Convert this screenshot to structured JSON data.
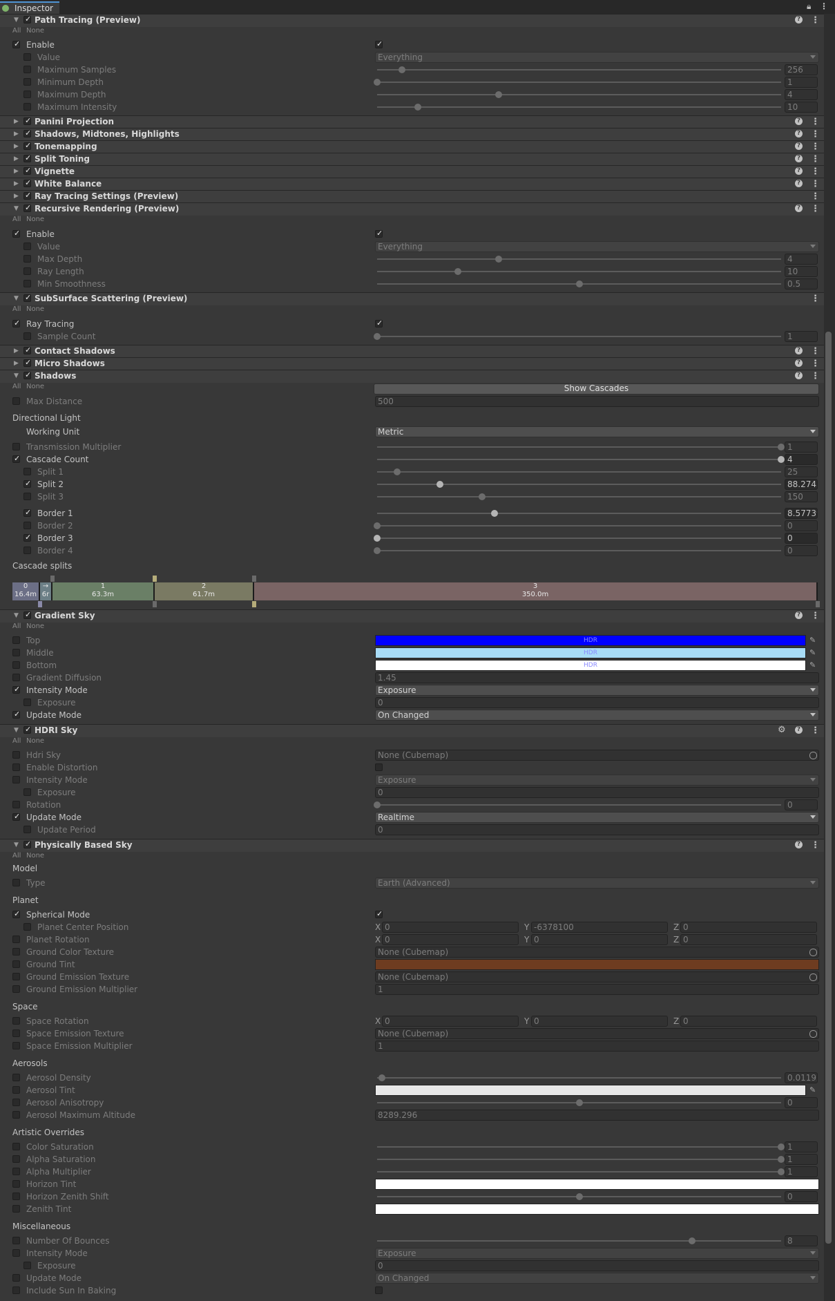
{
  "window": {
    "tab_label": "Inspector"
  },
  "path_tracing": {
    "title": "Path Tracing (Preview)",
    "all": "All",
    "none": "None",
    "enable": "Enable",
    "value_label": "Value",
    "value": "Everything",
    "max_samples_label": "Maximum Samples",
    "max_samples": "256",
    "min_depth_label": "Minimum Depth",
    "min_depth": "1",
    "max_depth_label": "Maximum Depth",
    "max_depth": "4",
    "max_intensity_label": "Maximum Intensity",
    "max_intensity": "10"
  },
  "collapsed": [
    "Panini Projection",
    "Shadows, Midtones, Highlights",
    "Tonemapping",
    "Split Toning",
    "Vignette",
    "White Balance",
    "Ray Tracing Settings (Preview)"
  ],
  "recursive": {
    "title": "Recursive Rendering (Preview)",
    "all": "All",
    "none": "None",
    "enable": "Enable",
    "value_label": "Value",
    "value": "Everything",
    "max_depth_label": "Max Depth",
    "max_depth": "4",
    "ray_length_label": "Ray Length",
    "ray_length": "10",
    "min_smooth_label": "Min Smoothness",
    "min_smooth": "0.5"
  },
  "sss": {
    "title": "SubSurface Scattering (Preview)",
    "all": "All",
    "none": "None",
    "ray_tracing": "Ray Tracing",
    "sample_count_label": "Sample Count",
    "sample_count": "1"
  },
  "collapsed2": [
    "Contact Shadows",
    "Micro Shadows"
  ],
  "shadows": {
    "title": "Shadows",
    "all": "All",
    "none": "None",
    "show_cascades": "Show Cascades",
    "max_distance_label": "Max Distance",
    "max_distance": "500",
    "directional_light": "Directional Light",
    "working_unit_label": "Working Unit",
    "working_unit": "Metric",
    "transmission_label": "Transmission  Multiplier",
    "transmission": "1",
    "cascade_count_label": "Cascade Count",
    "cascade_count": "4",
    "split1_label": "Split 1",
    "split1": "25",
    "split2_label": "Split 2",
    "split2": "88.2743",
    "split3_label": "Split 3",
    "split3": "150",
    "border1_label": "Border 1",
    "border1": "8.57739",
    "border2_label": "Border 2",
    "border2": "0",
    "border3_label": "Border 3",
    "border3": "0",
    "border4_label": "Border 4",
    "border4": "0",
    "cascade_splits_label": "Cascade splits",
    "segments": [
      {
        "idx": "0",
        "val": "16.4m",
        "color": "#6c6f86"
      },
      {
        "idx": "→",
        "val": "6r",
        "color": "#6c7f86"
      },
      {
        "idx": "1",
        "val": "63.3m",
        "color": "#6a7f66"
      },
      {
        "idx": "2",
        "val": "61.7m",
        "color": "#7a7a63"
      },
      {
        "idx": "3",
        "val": "350.0m",
        "color": "#7a6464"
      }
    ]
  },
  "gradient_sky": {
    "title": "Gradient Sky",
    "all": "All",
    "none": "None",
    "top_label": "Top",
    "top_color": "#0000ff",
    "middle_label": "Middle",
    "middle_color": "#a8dcf7",
    "bottom_label": "Bottom",
    "bottom_color": "#ffffff",
    "hdr": "HDR",
    "diffusion_label": "Gradient Diffusion",
    "diffusion": "1.45",
    "intensity_mode_label": "Intensity Mode",
    "intensity_mode": "Exposure",
    "exposure_label": "Exposure",
    "exposure": "0",
    "update_mode_label": "Update Mode",
    "update_mode": "On Changed"
  },
  "hdri_sky": {
    "title": "HDRI Sky",
    "all": "All",
    "none": "None",
    "hdri_label": "Hdri Sky",
    "hdri": "None (Cubemap)",
    "distortion_label": "Enable Distortion",
    "intensity_mode_label": "Intensity Mode",
    "intensity_mode": "Exposure",
    "exposure_label": "Exposure",
    "exposure": "0",
    "rotation_label": "Rotation",
    "rotation": "0",
    "update_mode_label": "Update Mode",
    "update_mode": "Realtime",
    "update_period_label": "Update Period",
    "update_period": "0"
  },
  "pbsky": {
    "title": "Physically Based Sky",
    "all": "All",
    "none": "None",
    "model": "Model",
    "type_label": "Type",
    "type": "Earth (Advanced)",
    "planet": "Planet",
    "spherical_label": "Spherical Mode",
    "center_label": "Planet Center Position",
    "center": {
      "x": "0",
      "y": "-6378100",
      "z": "0"
    },
    "rotation_label": "Planet Rotation",
    "rotation": {
      "x": "0",
      "y": "0",
      "z": "0"
    },
    "ground_color_tex_label": "Ground Color Texture",
    "ground_color_tex": "None (Cubemap)",
    "ground_tint_label": "Ground Tint",
    "ground_tint": "#6e3c20",
    "ground_emission_tex_label": "Ground Emission Texture",
    "ground_emission_tex": "None (Cubemap)",
    "ground_emission_mult_label": "Ground Emission Multiplier",
    "ground_emission_mult": "1",
    "space": "Space",
    "space_rot_label": "Space Rotation",
    "space_rot": {
      "x": "0",
      "y": "0",
      "z": "0"
    },
    "space_emission_tex_label": "Space Emission Texture",
    "space_emission_tex": "None (Cubemap)",
    "space_emission_mult_label": "Space Emission Multiplier",
    "space_emission_mult": "1",
    "aerosols": "Aerosols",
    "aero_density_label": "Aerosol Density",
    "aero_density": "0.01192",
    "aero_tint_label": "Aerosol Tint",
    "aero_aniso_label": "Aerosol Anisotropy",
    "aero_aniso": "0",
    "aero_alt_label": "Aerosol Maximum Altitude",
    "aero_alt": "8289.296",
    "artistic": "Artistic Overrides",
    "color_sat_label": "Color Saturation",
    "color_sat": "1",
    "alpha_sat_label": "Alpha Saturation",
    "alpha_sat": "1",
    "alpha_mult_label": "Alpha Multiplier",
    "alpha_mult": "1",
    "horizon_tint_label": "Horizon Tint",
    "horizon_shift_label": "Horizon Zenith Shift",
    "horizon_shift": "0",
    "zenith_tint_label": "Zenith Tint",
    "misc": "Miscellaneous",
    "bounces_label": "Number Of Bounces",
    "bounces": "8",
    "intensity_mode_label": "Intensity Mode",
    "intensity_mode": "Exposure",
    "exposure_label": "Exposure",
    "exposure": "0",
    "update_mode_label": "Update Mode",
    "update_mode": "On Changed",
    "sun_baking_label": "Include Sun In Baking"
  }
}
